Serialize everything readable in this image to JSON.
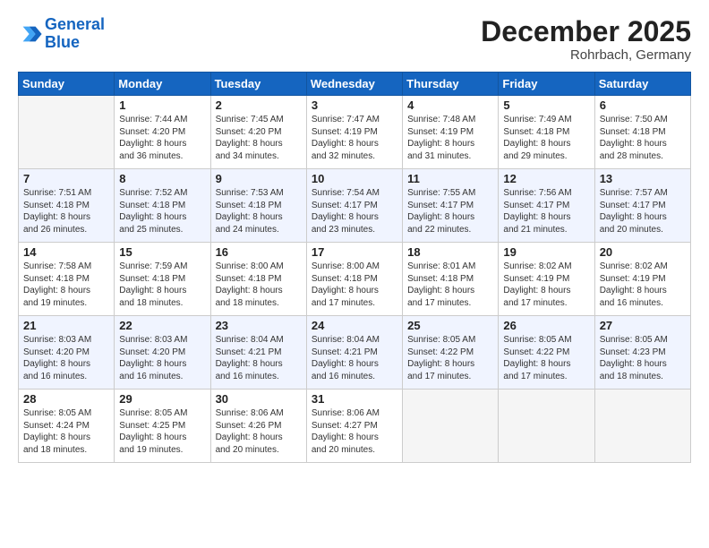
{
  "logo": {
    "line1": "General",
    "line2": "Blue"
  },
  "title": "December 2025",
  "subtitle": "Rohrbach, Germany",
  "weekdays": [
    "Sunday",
    "Monday",
    "Tuesday",
    "Wednesday",
    "Thursday",
    "Friday",
    "Saturday"
  ],
  "weeks": [
    [
      {
        "day": "",
        "info": ""
      },
      {
        "day": "1",
        "info": "Sunrise: 7:44 AM\nSunset: 4:20 PM\nDaylight: 8 hours\nand 36 minutes."
      },
      {
        "day": "2",
        "info": "Sunrise: 7:45 AM\nSunset: 4:20 PM\nDaylight: 8 hours\nand 34 minutes."
      },
      {
        "day": "3",
        "info": "Sunrise: 7:47 AM\nSunset: 4:19 PM\nDaylight: 8 hours\nand 32 minutes."
      },
      {
        "day": "4",
        "info": "Sunrise: 7:48 AM\nSunset: 4:19 PM\nDaylight: 8 hours\nand 31 minutes."
      },
      {
        "day": "5",
        "info": "Sunrise: 7:49 AM\nSunset: 4:18 PM\nDaylight: 8 hours\nand 29 minutes."
      },
      {
        "day": "6",
        "info": "Sunrise: 7:50 AM\nSunset: 4:18 PM\nDaylight: 8 hours\nand 28 minutes."
      }
    ],
    [
      {
        "day": "7",
        "info": "Sunrise: 7:51 AM\nSunset: 4:18 PM\nDaylight: 8 hours\nand 26 minutes."
      },
      {
        "day": "8",
        "info": "Sunrise: 7:52 AM\nSunset: 4:18 PM\nDaylight: 8 hours\nand 25 minutes."
      },
      {
        "day": "9",
        "info": "Sunrise: 7:53 AM\nSunset: 4:18 PM\nDaylight: 8 hours\nand 24 minutes."
      },
      {
        "day": "10",
        "info": "Sunrise: 7:54 AM\nSunset: 4:17 PM\nDaylight: 8 hours\nand 23 minutes."
      },
      {
        "day": "11",
        "info": "Sunrise: 7:55 AM\nSunset: 4:17 PM\nDaylight: 8 hours\nand 22 minutes."
      },
      {
        "day": "12",
        "info": "Sunrise: 7:56 AM\nSunset: 4:17 PM\nDaylight: 8 hours\nand 21 minutes."
      },
      {
        "day": "13",
        "info": "Sunrise: 7:57 AM\nSunset: 4:17 PM\nDaylight: 8 hours\nand 20 minutes."
      }
    ],
    [
      {
        "day": "14",
        "info": "Sunrise: 7:58 AM\nSunset: 4:18 PM\nDaylight: 8 hours\nand 19 minutes."
      },
      {
        "day": "15",
        "info": "Sunrise: 7:59 AM\nSunset: 4:18 PM\nDaylight: 8 hours\nand 18 minutes."
      },
      {
        "day": "16",
        "info": "Sunrise: 8:00 AM\nSunset: 4:18 PM\nDaylight: 8 hours\nand 18 minutes."
      },
      {
        "day": "17",
        "info": "Sunrise: 8:00 AM\nSunset: 4:18 PM\nDaylight: 8 hours\nand 17 minutes."
      },
      {
        "day": "18",
        "info": "Sunrise: 8:01 AM\nSunset: 4:18 PM\nDaylight: 8 hours\nand 17 minutes."
      },
      {
        "day": "19",
        "info": "Sunrise: 8:02 AM\nSunset: 4:19 PM\nDaylight: 8 hours\nand 17 minutes."
      },
      {
        "day": "20",
        "info": "Sunrise: 8:02 AM\nSunset: 4:19 PM\nDaylight: 8 hours\nand 16 minutes."
      }
    ],
    [
      {
        "day": "21",
        "info": "Sunrise: 8:03 AM\nSunset: 4:20 PM\nDaylight: 8 hours\nand 16 minutes."
      },
      {
        "day": "22",
        "info": "Sunrise: 8:03 AM\nSunset: 4:20 PM\nDaylight: 8 hours\nand 16 minutes."
      },
      {
        "day": "23",
        "info": "Sunrise: 8:04 AM\nSunset: 4:21 PM\nDaylight: 8 hours\nand 16 minutes."
      },
      {
        "day": "24",
        "info": "Sunrise: 8:04 AM\nSunset: 4:21 PM\nDaylight: 8 hours\nand 16 minutes."
      },
      {
        "day": "25",
        "info": "Sunrise: 8:05 AM\nSunset: 4:22 PM\nDaylight: 8 hours\nand 17 minutes."
      },
      {
        "day": "26",
        "info": "Sunrise: 8:05 AM\nSunset: 4:22 PM\nDaylight: 8 hours\nand 17 minutes."
      },
      {
        "day": "27",
        "info": "Sunrise: 8:05 AM\nSunset: 4:23 PM\nDaylight: 8 hours\nand 18 minutes."
      }
    ],
    [
      {
        "day": "28",
        "info": "Sunrise: 8:05 AM\nSunset: 4:24 PM\nDaylight: 8 hours\nand 18 minutes."
      },
      {
        "day": "29",
        "info": "Sunrise: 8:05 AM\nSunset: 4:25 PM\nDaylight: 8 hours\nand 19 minutes."
      },
      {
        "day": "30",
        "info": "Sunrise: 8:06 AM\nSunset: 4:26 PM\nDaylight: 8 hours\nand 20 minutes."
      },
      {
        "day": "31",
        "info": "Sunrise: 8:06 AM\nSunset: 4:27 PM\nDaylight: 8 hours\nand 20 minutes."
      },
      {
        "day": "",
        "info": ""
      },
      {
        "day": "",
        "info": ""
      },
      {
        "day": "",
        "info": ""
      }
    ]
  ]
}
